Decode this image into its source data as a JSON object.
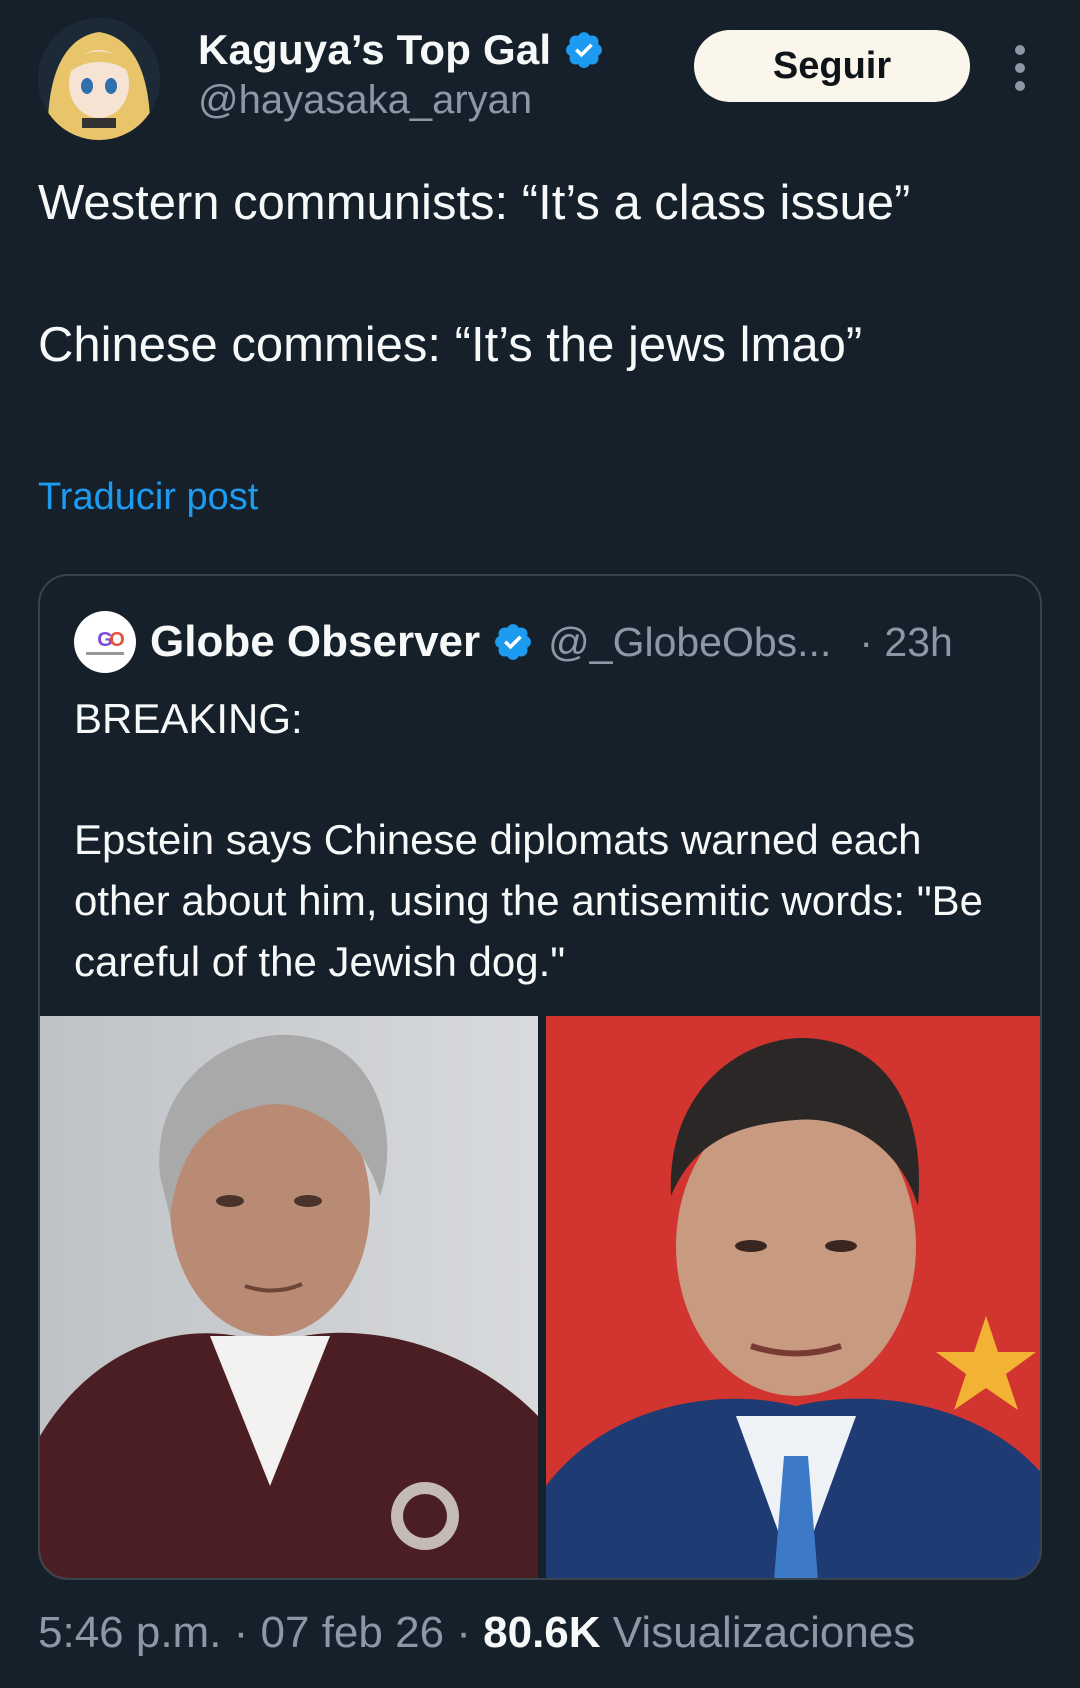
{
  "post": {
    "author": {
      "display_name": "Kaguya’s Top Gal",
      "handle": "@hayasaka_aryan",
      "verified": true
    },
    "follow_label": "Seguir",
    "more_icon": "more-vertical-icon",
    "text_line_1": "Western communists: “It’s a class issue”",
    "text_line_2": "Chinese commies: “It’s the jews lmao”",
    "translate_label": "Traducir post"
  },
  "quote": {
    "author": {
      "display_name": "Globe Observer",
      "handle": "@_GlobeObs...",
      "verified": true
    },
    "time": "· 23h",
    "text_line_1": "BREAKING:",
    "text_line_2": "Epstein says Chinese diplomats warned each other about him, using the antisemitic words: \"Be careful of the Jewish dog.\"",
    "media": [
      "photo-left",
      "photo-right"
    ]
  },
  "footer": {
    "time": "5:46 p.m. · 07 feb 26 · ",
    "views_count": "80.6K",
    "views_label": " Visualizaciones"
  },
  "colors": {
    "background": "#15202b",
    "text_primary": "#f7f9f9",
    "text_secondary": "#8b98a5",
    "accent": "#1d9bf0",
    "border": "#38444d",
    "follow_button_bg": "#fbf6ec"
  }
}
